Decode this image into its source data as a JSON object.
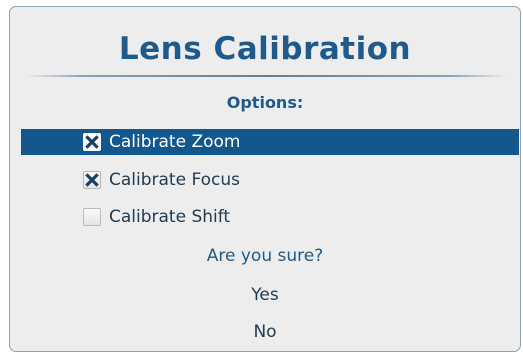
{
  "dialog": {
    "title": "Lens Calibration",
    "section_header": "Options:",
    "options": [
      {
        "label": "Calibrate Zoom",
        "checked": true,
        "selected": true
      },
      {
        "label": "Calibrate Focus",
        "checked": true,
        "selected": false
      },
      {
        "label": "Calibrate Shift",
        "checked": false,
        "selected": false
      }
    ],
    "prompt": "Are you sure?",
    "yes_label": "Yes",
    "no_label": "No"
  },
  "colors": {
    "accent": "#1e5a8c",
    "selection": "#14578c",
    "background": "#ededed",
    "checkmark": "#1b3f63"
  },
  "icons": {
    "checked": "x-checkmark-icon",
    "unchecked": "empty-checkbox-icon"
  }
}
